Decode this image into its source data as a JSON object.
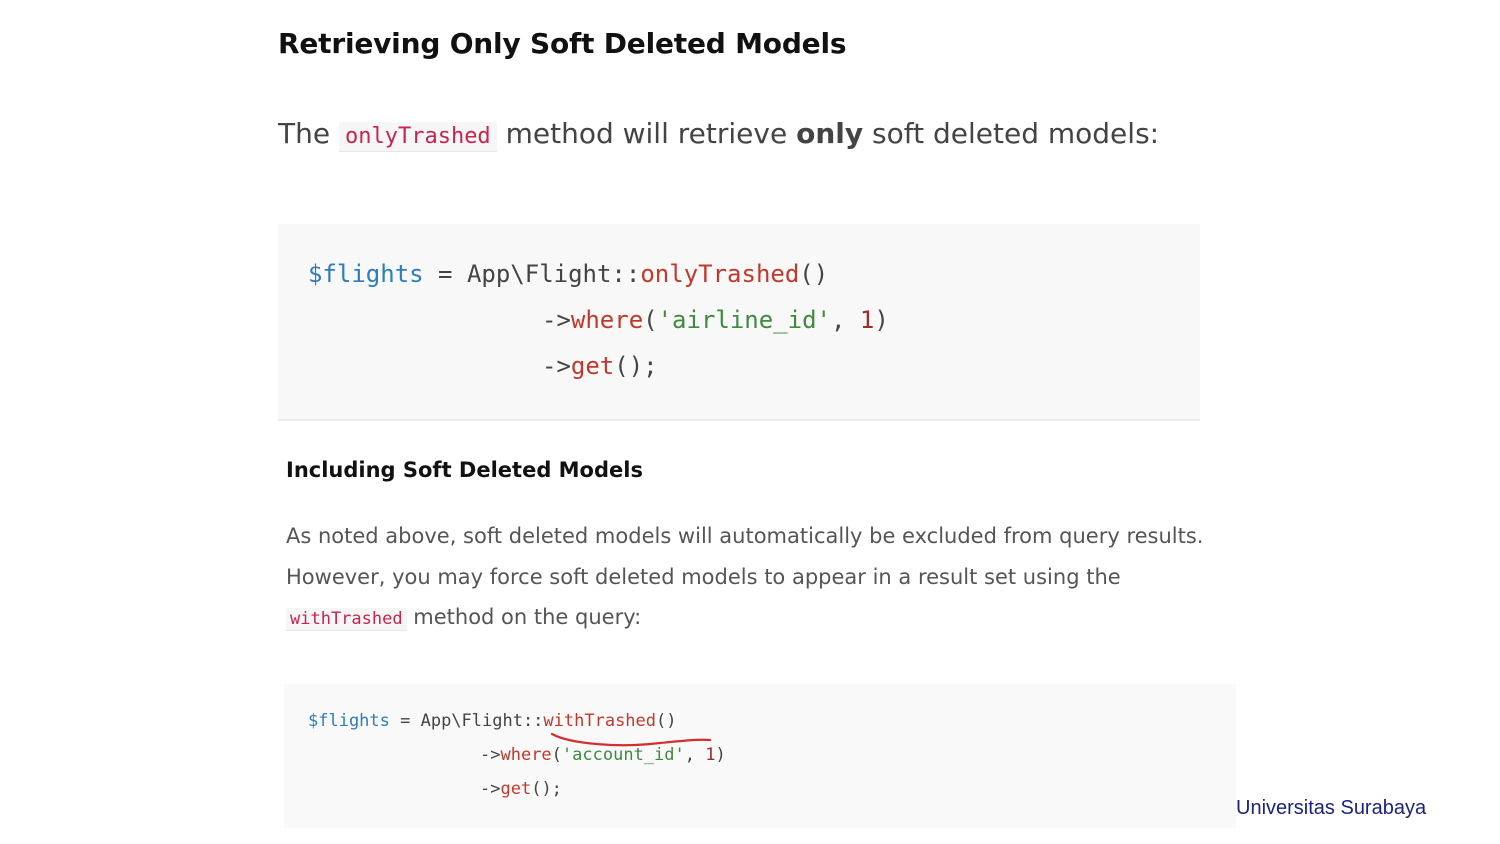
{
  "heading": "Retrieving Only Soft Deleted Models",
  "intro": {
    "before": "The",
    "code": "onlyTrashed",
    "middle": "method will retrieve",
    "bold": "only",
    "after": "soft deleted models:"
  },
  "code_block_1": {
    "line1": {
      "var": "$flights",
      "plain": " = App\\Flight::",
      "fn": "onlyTrashed",
      "end": "()"
    },
    "line2": {
      "arrow": "->",
      "fn": "where",
      "open": "(",
      "str": "'airline_id'",
      "sep": ", ",
      "num": "1",
      "close": ")"
    },
    "line3": {
      "arrow": "->",
      "fn": "get",
      "end": "();"
    }
  },
  "subheading": "Including Soft Deleted Models",
  "paragraph": {
    "line1": "As noted above, soft deleted models will automatically be excluded from query results.",
    "line2": "However, you may force soft deleted models to appear in a result set using the",
    "code": "withTrashed",
    "line3_rest": "method on the query:"
  },
  "code_block_2": {
    "line1": {
      "var": "$flights",
      "plain": " = App\\Flight::",
      "fn": "withTrashed",
      "end": "()"
    },
    "line2": {
      "arrow": "->",
      "fn": "where",
      "open": "(",
      "str": "'account_id'",
      "sep": ", ",
      "num": "1",
      "close": ")"
    },
    "line3": {
      "arrow": "->",
      "fn": "get",
      "end": "();"
    }
  },
  "annotation_color": "#d32f2f",
  "footer": "Universitas Surabaya"
}
